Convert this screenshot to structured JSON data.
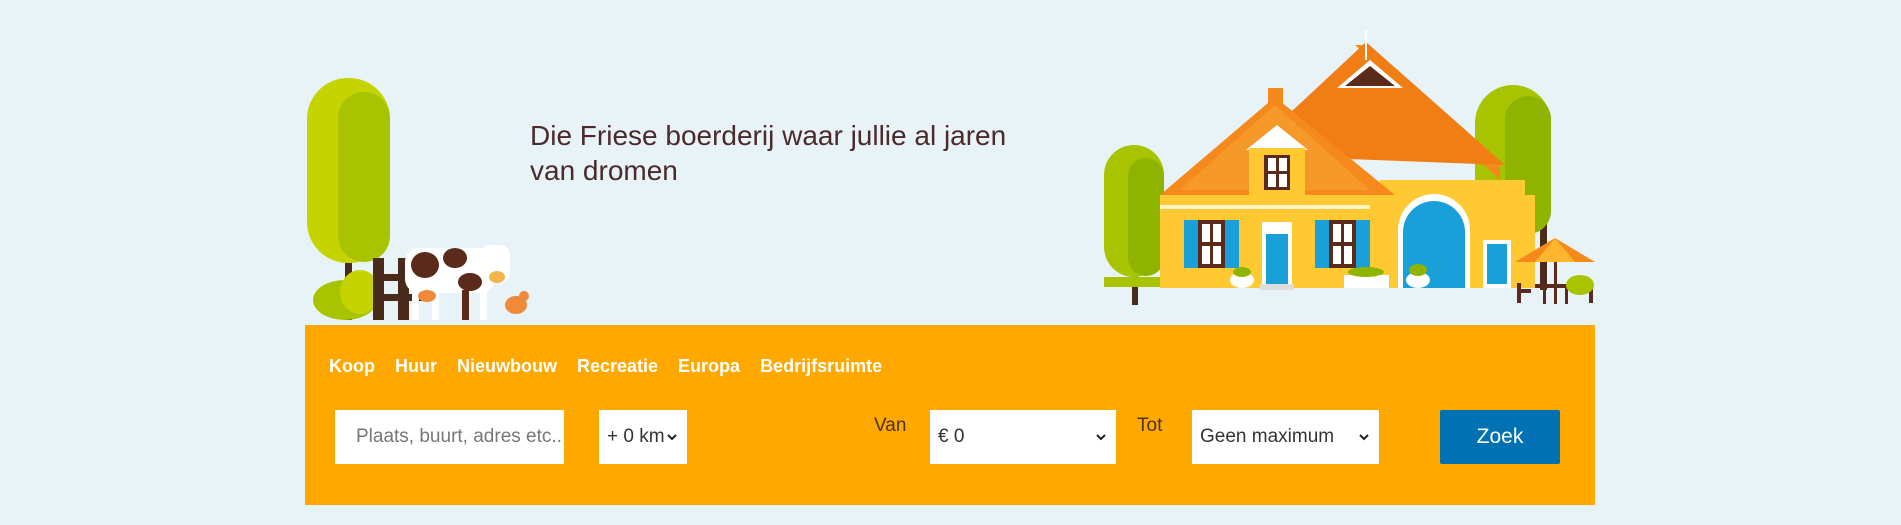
{
  "hero": {
    "tagline": "Die Friese boerderij waar jullie al jaren van dromen"
  },
  "search": {
    "tabs": [
      {
        "label": "Koop"
      },
      {
        "label": "Huur"
      },
      {
        "label": "Nieuwbouw"
      },
      {
        "label": "Recreatie"
      },
      {
        "label": "Europa"
      },
      {
        "label": "Bedrijfsruimte"
      }
    ],
    "location_placeholder": "Plaats, buurt, adres etc..",
    "radius_value": "+ 0 km",
    "from_label": "Van",
    "from_value": "€ 0",
    "to_label": "Tot",
    "to_value": "Geen maximum",
    "submit_label": "Zoek"
  },
  "colors": {
    "panel": "#ffa800",
    "button": "#0071b3",
    "background": "#e8f3f8",
    "tagline": "#4a2a2a"
  }
}
